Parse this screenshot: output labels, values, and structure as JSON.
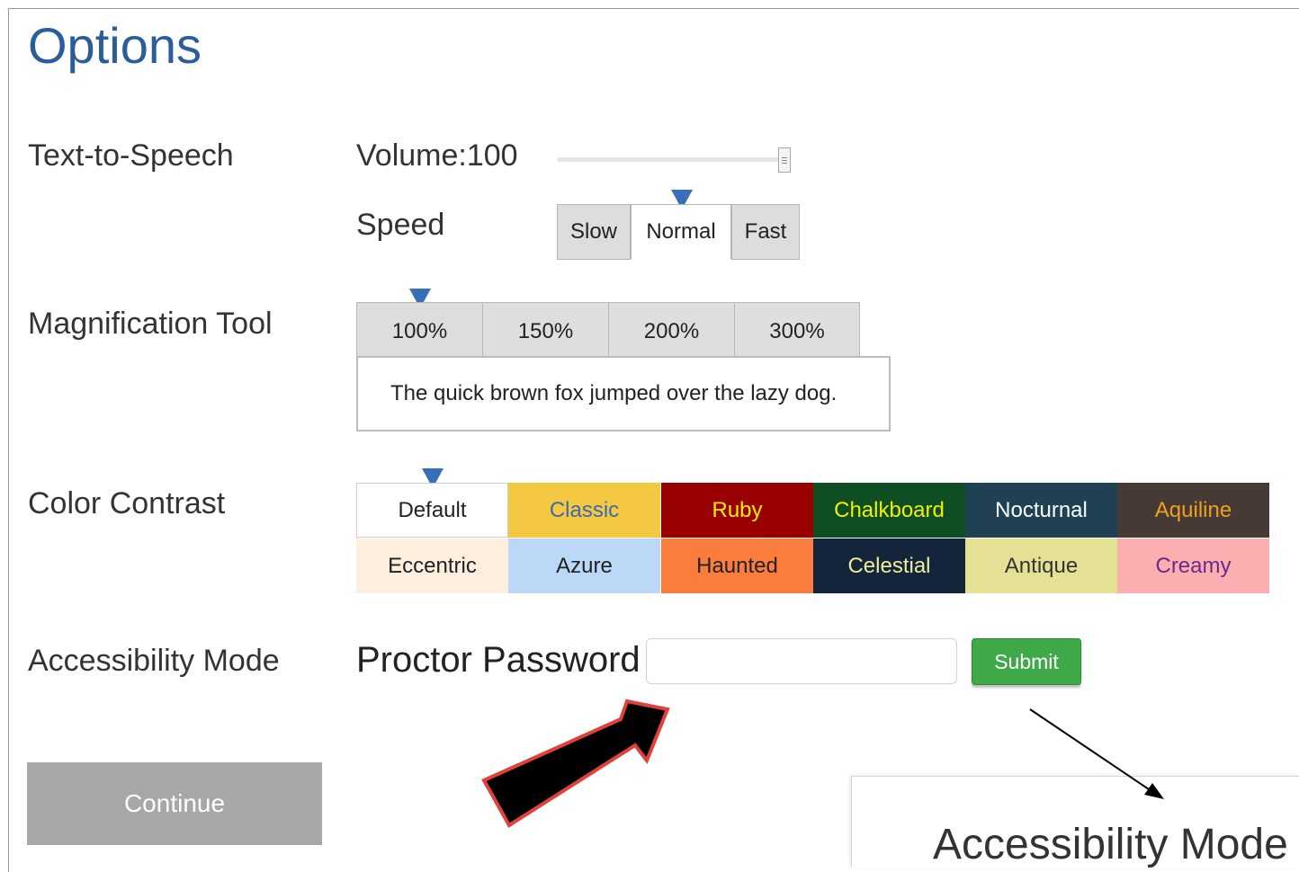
{
  "page_title": "Options",
  "tts": {
    "label": "Text-to-Speech",
    "volume_label": "Volume:100",
    "volume_value": 100,
    "speed_label": "Speed",
    "speed_options": [
      "Slow",
      "Normal",
      "Fast"
    ],
    "speed_selected": "Normal"
  },
  "magnification": {
    "label": "Magnification Tool",
    "options": [
      "100%",
      "150%",
      "200%",
      "300%"
    ],
    "selected": "100%",
    "sample_text": "The quick brown fox jumped over the lazy dog."
  },
  "color_contrast": {
    "label": "Color Contrast",
    "selected": "Default",
    "themes": [
      {
        "name": "Default",
        "bg": "#ffffff",
        "fg": "#222222"
      },
      {
        "name": "Classic",
        "bg": "#f5c842",
        "fg": "#3a6ab0"
      },
      {
        "name": "Ruby",
        "bg": "#990000",
        "fg": "#ffee00"
      },
      {
        "name": "Chalkboard",
        "bg": "#0f4d22",
        "fg": "#f0f000"
      },
      {
        "name": "Nocturnal",
        "bg": "#1f4153",
        "fg": "#ffffff"
      },
      {
        "name": "Aquiline",
        "bg": "#453a34",
        "fg": "#f0a020"
      },
      {
        "name": "Eccentric",
        "bg": "#fdeedd",
        "fg": "#222222"
      },
      {
        "name": "Azure",
        "bg": "#bbd8f7",
        "fg": "#222222"
      },
      {
        "name": "Haunted",
        "bg": "#fb7d3e",
        "fg": "#222222"
      },
      {
        "name": "Celestial",
        "bg": "#14243b",
        "fg": "#eeee99"
      },
      {
        "name": "Antique",
        "bg": "#e5e194",
        "fg": "#333333"
      },
      {
        "name": "Creamy",
        "bg": "#fcaeb0",
        "fg": "#6a2a8a"
      }
    ]
  },
  "accessibility": {
    "label": "Accessibility Mode",
    "password_label": "Proctor Password",
    "password_value": "",
    "submit_label": "Submit"
  },
  "continue_label": "Continue",
  "popup": {
    "title": "Accessibility Mode"
  },
  "colors": {
    "title_blue": "#2a5d9a",
    "marker_blue": "#3570b9",
    "submit_green": "#3fa94a",
    "continue_gray": "#a7a7a7",
    "arrow_fill": "#000000",
    "arrow_outline": "#e0413a"
  }
}
